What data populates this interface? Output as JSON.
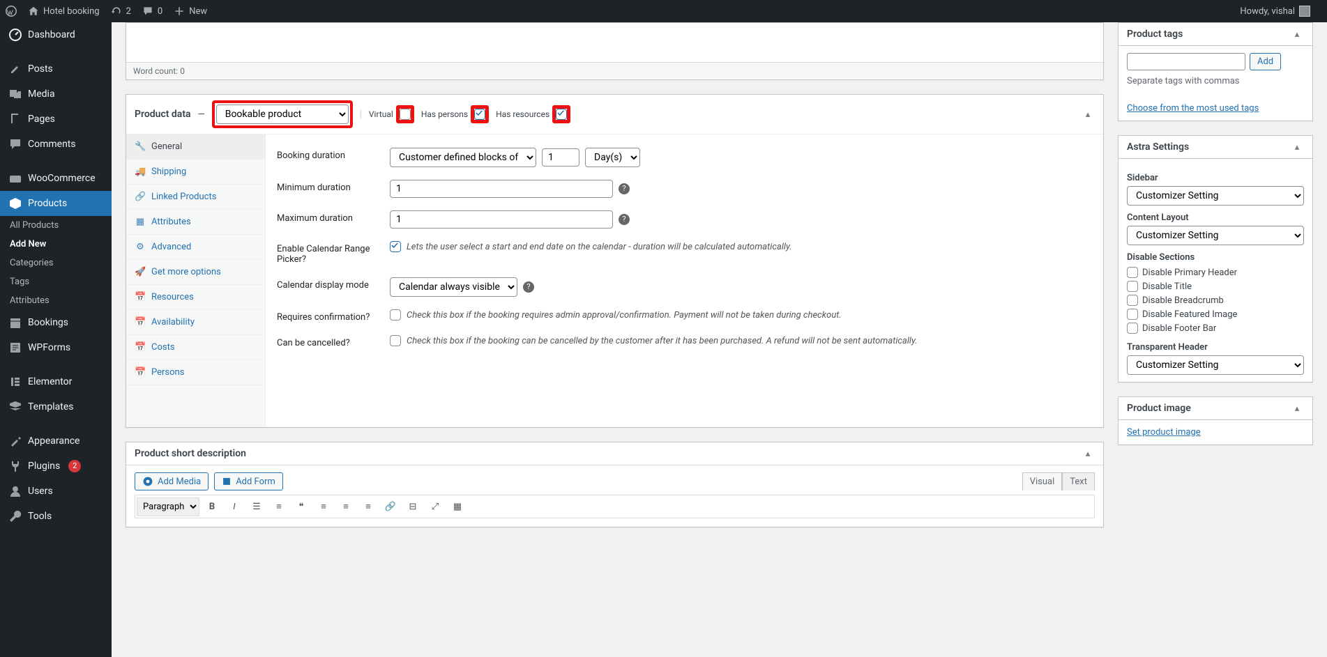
{
  "adminbar": {
    "site_name": "Hotel booking",
    "updates": "2",
    "comments": "0",
    "new": "New",
    "howdy": "Howdy, vishal"
  },
  "menu": {
    "dashboard": "Dashboard",
    "posts": "Posts",
    "media": "Media",
    "pages": "Pages",
    "comments": "Comments",
    "woocommerce": "WooCommerce",
    "products": "Products",
    "products_sub": {
      "all": "All Products",
      "add": "Add New",
      "cat": "Categories",
      "tags": "Tags",
      "attr": "Attributes"
    },
    "bookings": "Bookings",
    "wpforms": "WPForms",
    "elementor": "Elementor",
    "templates": "Templates",
    "appearance": "Appearance",
    "plugins": "Plugins",
    "plugins_badge": "2",
    "users": "Users",
    "tools": "Tools"
  },
  "editor": {
    "wordcount_label": "Word count: ",
    "wordcount_value": "0"
  },
  "product_data": {
    "heading": "Product data",
    "dash": "—",
    "type": "Bookable product",
    "virtual": "Virtual",
    "has_persons": "Has persons",
    "has_resources": "Has resources",
    "tabs": {
      "general": "General",
      "shipping": "Shipping",
      "linked": "Linked Products",
      "attributes": "Attributes",
      "advanced": "Advanced",
      "get_more": "Get more options",
      "resources": "Resources",
      "availability": "Availability",
      "costs": "Costs",
      "persons": "Persons"
    },
    "fields": {
      "booking_duration": {
        "label": "Booking duration",
        "mode": "Customer defined blocks of",
        "qty": "1",
        "unit": "Day(s)"
      },
      "min_duration": {
        "label": "Minimum duration",
        "value": "1"
      },
      "max_duration": {
        "label": "Maximum duration",
        "value": "1"
      },
      "range_picker": {
        "label": "Enable Calendar Range Picker?",
        "desc": "Lets the user select a start and end date on the calendar - duration will be calculated automatically."
      },
      "cal_mode": {
        "label": "Calendar display mode",
        "value": "Calendar always visible"
      },
      "requires_conf": {
        "label": "Requires confirmation?",
        "desc": "Check this box if the booking requires admin approval/confirmation. Payment will not be taken during checkout."
      },
      "cancellable": {
        "label": "Can be cancelled?",
        "desc": "Check this box if the booking can be cancelled by the customer after it has been purchased. A refund will not be sent automatically."
      }
    }
  },
  "short_desc": {
    "title": "Product short description",
    "add_media": "Add Media",
    "add_form": "Add Form",
    "visual": "Visual",
    "text": "Text",
    "format": "Paragraph"
  },
  "side": {
    "tags": {
      "title": "Product tags",
      "add": "Add",
      "hint": "Separate tags with commas",
      "link": "Choose from the most used tags"
    },
    "astra": {
      "title": "Astra Settings",
      "sidebar_label": "Sidebar",
      "sidebar_val": "Customizer Setting",
      "content_label": "Content Layout",
      "content_val": "Customizer Setting",
      "disable_label": "Disable Sections",
      "disable": {
        "header": "Disable Primary Header",
        "title": "Disable Title",
        "breadcrumb": "Disable Breadcrumb",
        "featured": "Disable Featured Image",
        "footer": "Disable Footer Bar"
      },
      "transparent_label": "Transparent Header",
      "transparent_val": "Customizer Setting"
    },
    "image": {
      "title": "Product image",
      "link": "Set product image"
    }
  }
}
